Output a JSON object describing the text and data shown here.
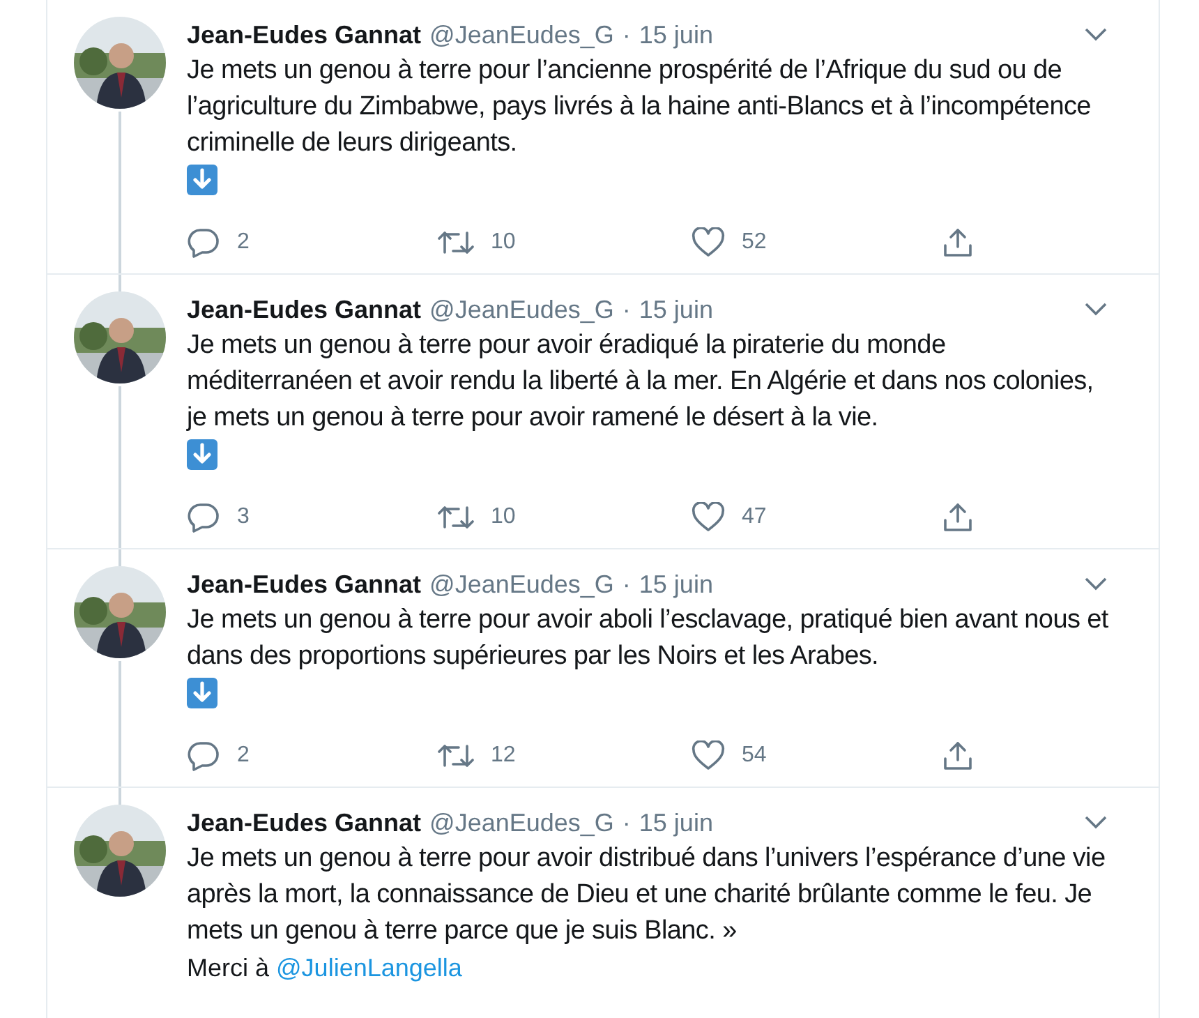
{
  "tweets": [
    {
      "name": "Jean-Eudes Gannat",
      "handle": "@JeanEudes_G",
      "separator": "·",
      "date": "15 juin",
      "body": "Je mets un genou à terre pour l’ancienne prospérité de l’Afrique du sud ou de l’agriculture du Zimbabwe, pays livrés à la haine anti-Blancs et à l’incompétence criminelle de leurs dirigeants.",
      "arrow_emoji": true,
      "replies": "2",
      "retweets": "10",
      "likes": "52",
      "thread_continues": true
    },
    {
      "name": "Jean-Eudes Gannat",
      "handle": "@JeanEudes_G",
      "separator": "·",
      "date": "15 juin",
      "body": "Je mets un genou à terre pour avoir éradiqué la piraterie du monde méditerranéen et avoir rendu la liberté à la mer. En Algérie et dans nos colonies, je mets un genou à terre pour avoir ramené le désert à la vie.",
      "arrow_emoji": true,
      "replies": "3",
      "retweets": "10",
      "likes": "47",
      "thread_continues": true
    },
    {
      "name": "Jean-Eudes Gannat",
      "handle": "@JeanEudes_G",
      "separator": "·",
      "date": "15 juin",
      "body": "Je mets un genou à terre pour avoir aboli l’esclavage, pratiqué bien avant nous et dans des proportions supérieures par les Noirs et les Arabes.",
      "arrow_emoji": true,
      "replies": "2",
      "retweets": "12",
      "likes": "54",
      "thread_continues": true
    },
    {
      "name": "Jean-Eudes Gannat",
      "handle": "@JeanEudes_G",
      "separator": "·",
      "date": "15 juin",
      "body": "Je mets un genou à terre pour avoir distribué dans l’univers l’espérance d’une vie après la mort, la connaissance de Dieu et une charité brûlante comme le feu. Je mets un genou à terre parce que je suis Blanc. »",
      "thanks": {
        "text": "Merci à",
        "mention": "@JulienLangella"
      },
      "arrow_emoji": false,
      "thread_continues": false
    }
  ]
}
